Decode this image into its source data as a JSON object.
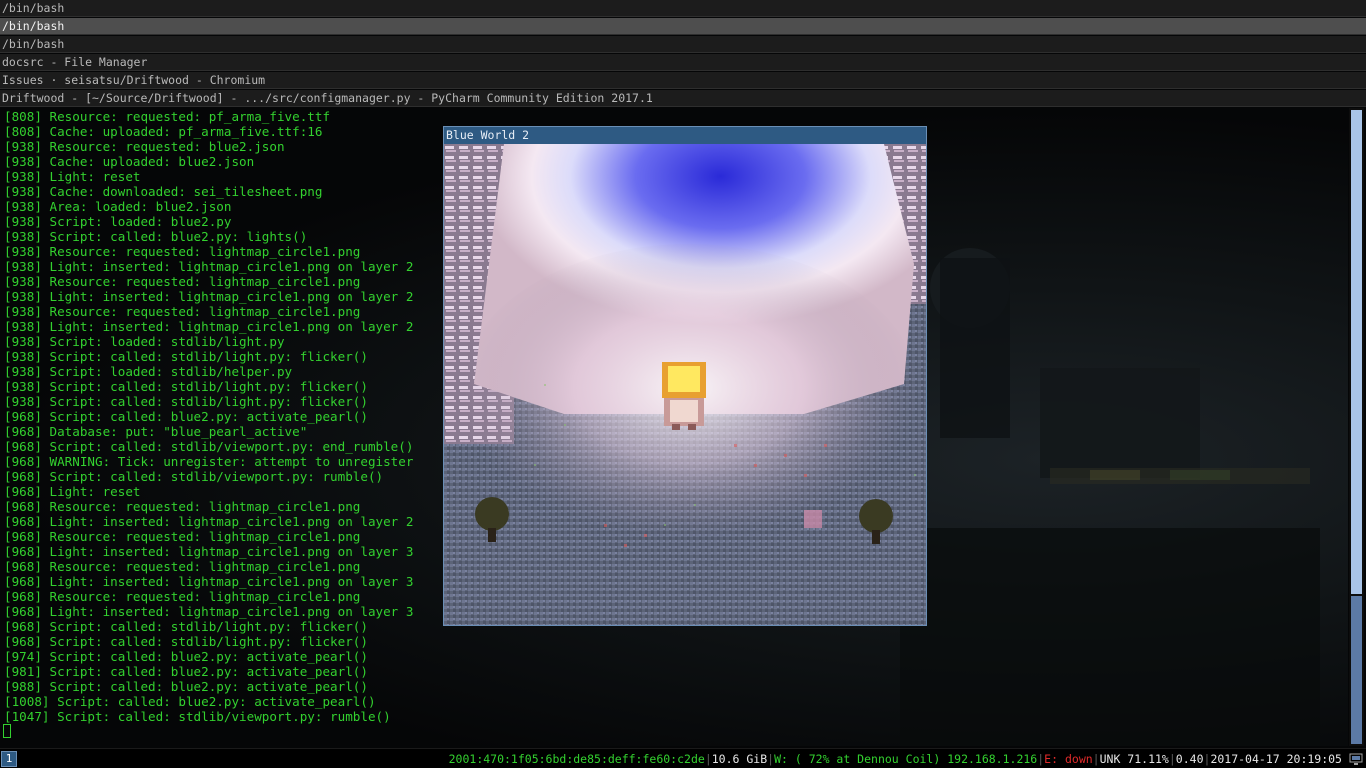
{
  "tabs": [
    {
      "title": "/bin/bash",
      "active": false
    },
    {
      "title": "/bin/bash",
      "active": true
    },
    {
      "title": "/bin/bash",
      "active": false
    },
    {
      "title": "docsrc - File Manager",
      "active": false
    },
    {
      "title": "Issues · seisatsu/Driftwood - Chromium",
      "active": false
    },
    {
      "title": "Driftwood - [~/Source/Driftwood] - .../src/configmanager.py - PyCharm Community Edition 2017.1",
      "active": false
    }
  ],
  "terminal": {
    "lines": [
      "[808] Resource: requested: pf_arma_five.ttf",
      "[808] Cache: uploaded: pf_arma_five.ttf:16",
      "[938] Resource: requested: blue2.json",
      "[938] Cache: uploaded: blue2.json",
      "[938] Light: reset",
      "[938] Cache: downloaded: sei_tilesheet.png",
      "[938] Area: loaded: blue2.json",
      "[938] Script: loaded: blue2.py",
      "[938] Script: called: blue2.py: lights()",
      "[938] Resource: requested: lightmap_circle1.png",
      "[938] Light: inserted: lightmap_circle1.png on layer 2",
      "[938] Resource: requested: lightmap_circle1.png",
      "[938] Light: inserted: lightmap_circle1.png on layer 2",
      "[938] Resource: requested: lightmap_circle1.png",
      "[938] Light: inserted: lightmap_circle1.png on layer 2",
      "[938] Script: loaded: stdlib/light.py",
      "[938] Script: called: stdlib/light.py: flicker()",
      "[938] Script: loaded: stdlib/helper.py",
      "[938] Script: called: stdlib/light.py: flicker()",
      "[938] Script: called: stdlib/light.py: flicker()",
      "[968] Script: called: blue2.py: activate_pearl()",
      "[968] Database: put: \"blue_pearl_active\"",
      "[968] Script: called: stdlib/viewport.py: end_rumble()",
      "[968] WARNING: Tick: unregister: attempt to unregister",
      "[968] Script: called: stdlib/viewport.py: rumble()",
      "[968] Light: reset",
      "[968] Resource: requested: lightmap_circle1.png",
      "[968] Light: inserted: lightmap_circle1.png on layer 2",
      "[968] Resource: requested: lightmap_circle1.png",
      "[968] Light: inserted: lightmap_circle1.png on layer 3",
      "[968] Resource: requested: lightmap_circle1.png",
      "[968] Light: inserted: lightmap_circle1.png on layer 3",
      "[968] Resource: requested: lightmap_circle1.png",
      "[968] Light: inserted: lightmap_circle1.png on layer 3",
      "[968] Script: called: stdlib/light.py: flicker()",
      "[968] Script: called: stdlib/light.py: flicker()",
      "[974] Script: called: blue2.py: activate_pearl()",
      "[981] Script: called: blue2.py: activate_pearl()",
      "[988] Script: called: blue2.py: activate_pearl()",
      "[1008] Script: called: blue2.py: activate_pearl()",
      "[1047] Script: called: stdlib/viewport.py: rumble()"
    ]
  },
  "game_window": {
    "title": "Blue World 2"
  },
  "statusbar": {
    "workspace": "1",
    "ipv6": "2001:470:1f05:6bd:de85:deff:fe60:c2de",
    "disk": "10.6 GiB",
    "wifi_prefix": "W:",
    "wifi": "( 72% at Dennou Coil)",
    "ipv4": "192.168.1.216",
    "eth_prefix": "E:",
    "eth": "down",
    "battery": "UNK 71.11%",
    "load": "0.40",
    "datetime": "2017-04-17 20:19:05"
  },
  "colors": {
    "terminal_text": "#33d12f",
    "active_tab": "#4e4e4e",
    "game_title_bar": "#2e5a83",
    "status_error": "#e02a2a"
  }
}
